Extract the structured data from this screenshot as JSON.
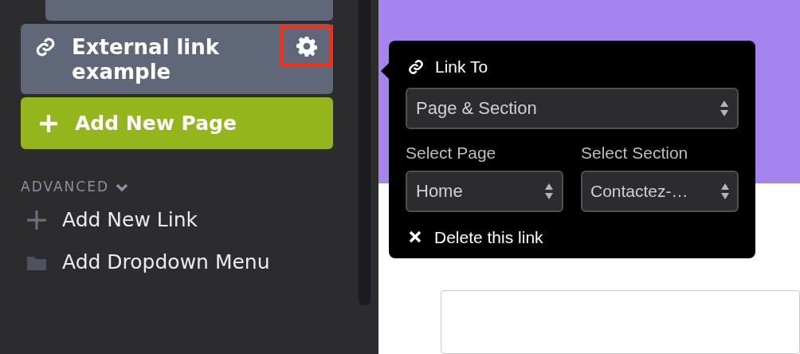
{
  "sidebar": {
    "pages": [
      {
        "kind": "page"
      },
      {
        "kind": "link",
        "label": "External link example",
        "settings_highlighted": true
      }
    ],
    "add_page_button": "Add New Page",
    "advanced": {
      "label": "ADVANCED",
      "expanded": true,
      "items": [
        {
          "kind": "add",
          "label": "Add New Link"
        },
        {
          "kind": "folder",
          "label": "Add Dropdown Menu"
        }
      ]
    }
  },
  "link_popup": {
    "title": "Link To",
    "link_type": "Page & Section",
    "page_label": "Select Page",
    "page_value": "Home",
    "section_label": "Select Section",
    "section_value": "Contactez-…",
    "delete": "Delete this link"
  }
}
